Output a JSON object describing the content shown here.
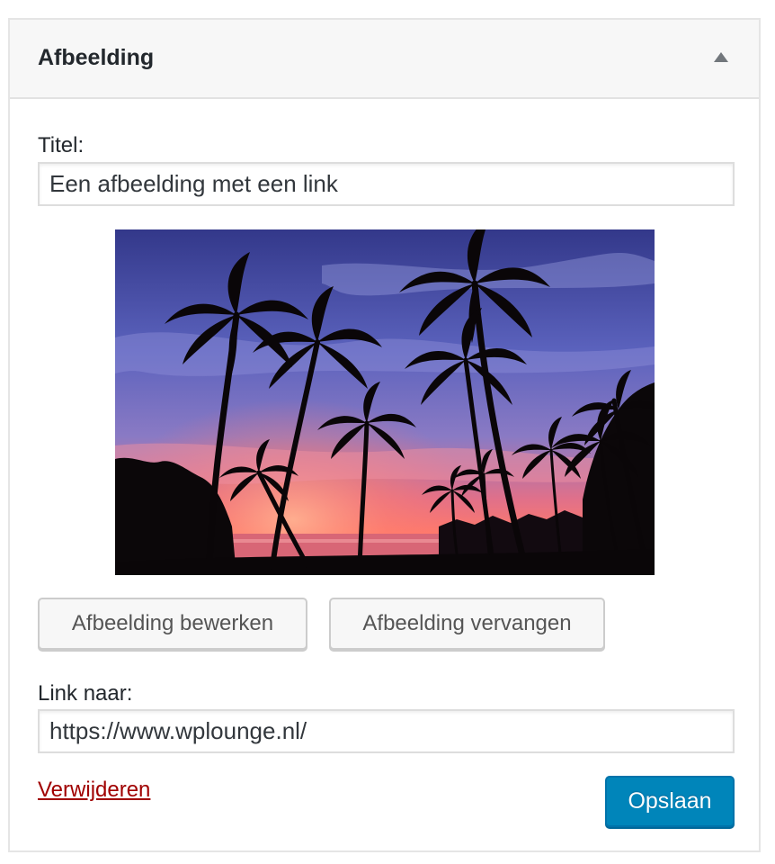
{
  "widget": {
    "title": "Afbeelding",
    "toggle_icon": "triangle-up-icon"
  },
  "form": {
    "title_label": "Titel:",
    "title_value": "Een afbeelding met een link",
    "image": {
      "description": "silhouetted palm trees against a sunset sky",
      "colors": {
        "sky_top": "#3b3f8e",
        "sky_mid": "#6a6fc4",
        "horizon": "#f26b6b",
        "sun_glow": "#ff8a5c",
        "silhouette": "#0a0608"
      }
    },
    "edit_button_label": "Afbeelding bewerken",
    "replace_button_label": "Afbeelding vervangen",
    "link_label": "Link naar:",
    "link_value": "https://www.wplounge.nl/"
  },
  "actions": {
    "remove_label": "Verwijderen",
    "save_label": "Opslaan"
  },
  "colors": {
    "primary": "#0085ba",
    "remove": "#a00000",
    "text": "#23282d"
  }
}
